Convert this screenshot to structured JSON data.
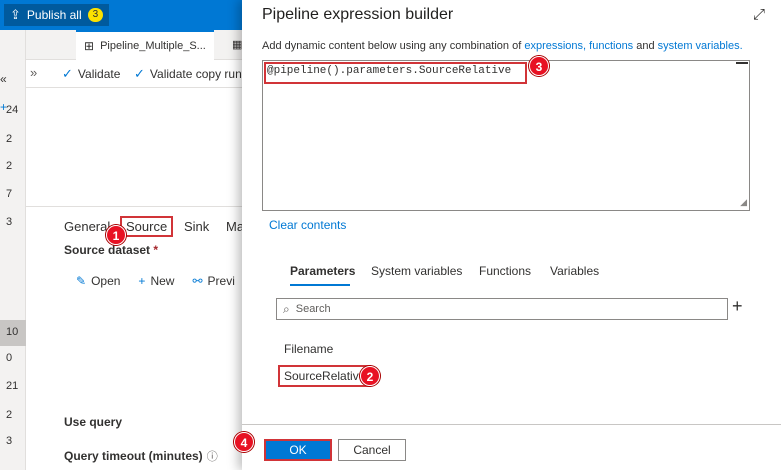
{
  "app": {
    "publish_label": "Publish all",
    "publish_count": "3",
    "pipeline_tab": "Pipeline_Multiple_S...",
    "left_numbers": [
      "24",
      "2",
      "2",
      "7",
      "3",
      "10",
      "0",
      "21",
      "2",
      "3"
    ],
    "toolbar": {
      "validate": "Validate",
      "validate_copy": "Validate copy runt"
    },
    "prop_tabs": {
      "general": "General",
      "source": "Source",
      "sink": "Sink",
      "mapping": "Ma"
    },
    "source_dataset_label": "Source dataset",
    "required_mark": "*",
    "actions": {
      "open": "Open",
      "new": "New",
      "preview": "Previ"
    },
    "use_query_label": "Use query",
    "query_timeout_label": "Query timeout (minutes)"
  },
  "dialog": {
    "title": "Pipeline expression builder",
    "description_prefix": "Add dynamic content below using any combination of ",
    "link_expressions": "expressions,",
    "link_functions": "functions",
    "and_text": " and ",
    "link_system_variables": "system variables.",
    "expression_value": "@pipeline().parameters.SourceRelative",
    "clear_contents": "Clear contents",
    "tabs": [
      "Parameters",
      "System variables",
      "Functions",
      "Variables"
    ],
    "search_placeholder": "Search",
    "params_heading": "Filename",
    "param_item": "SourceRelative",
    "ok_label": "OK",
    "cancel_label": "Cancel"
  },
  "steps": [
    "1",
    "2",
    "3",
    "4"
  ],
  "colors": {
    "accent": "#0078d4",
    "highlight": "#d13438",
    "step_badge": "#e81123"
  }
}
